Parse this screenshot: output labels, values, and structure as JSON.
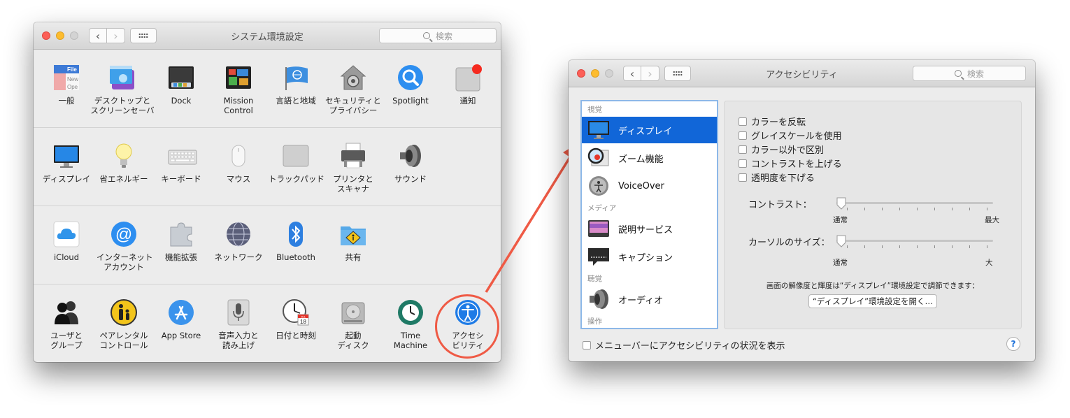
{
  "left_window": {
    "title": "システム環境設定",
    "search_placeholder": "検索",
    "back_glyph": "‹",
    "forward_glyph": "›",
    "rows": [
      [
        {
          "name": "general",
          "label": [
            "一般"
          ],
          "icon": "general-icon"
        },
        {
          "name": "desktop",
          "label": [
            "デスクトップと",
            "スクリーンセーバ"
          ],
          "icon": "desktop-icon"
        },
        {
          "name": "dock",
          "label": [
            "Dock"
          ],
          "icon": "dock-icon"
        },
        {
          "name": "mission-control",
          "label": [
            "Mission",
            "Control"
          ],
          "icon": "mission-control-icon"
        },
        {
          "name": "language",
          "label": [
            "言語と地域"
          ],
          "icon": "language-flag-icon"
        },
        {
          "name": "security",
          "label": [
            "セキュリティと",
            "プライバシー"
          ],
          "icon": "security-house-icon"
        },
        {
          "name": "spotlight",
          "label": [
            "Spotlight"
          ],
          "icon": "spotlight-icon"
        },
        {
          "name": "notifications",
          "label": [
            "通知"
          ],
          "icon": "notifications-icon"
        }
      ],
      [
        {
          "name": "displays",
          "label": [
            "ディスプレイ"
          ],
          "icon": "display-icon"
        },
        {
          "name": "energy",
          "label": [
            "省エネルギー"
          ],
          "icon": "lightbulb-icon"
        },
        {
          "name": "keyboard",
          "label": [
            "キーボード"
          ],
          "icon": "keyboard-icon"
        },
        {
          "name": "mouse",
          "label": [
            "マウス"
          ],
          "icon": "mouse-icon"
        },
        {
          "name": "trackpad",
          "label": [
            "トラックパッド"
          ],
          "icon": "trackpad-icon"
        },
        {
          "name": "printers",
          "label": [
            "プリンタと",
            "スキャナ"
          ],
          "icon": "printer-icon"
        },
        {
          "name": "sound",
          "label": [
            "サウンド"
          ],
          "icon": "speaker-icon"
        }
      ],
      [
        {
          "name": "icloud",
          "label": [
            "iCloud"
          ],
          "icon": "icloud-icon"
        },
        {
          "name": "internet-accounts",
          "label": [
            "インターネット",
            "アカウント"
          ],
          "icon": "at-sign-icon"
        },
        {
          "name": "extensions",
          "label": [
            "機能拡張"
          ],
          "icon": "puzzle-icon"
        },
        {
          "name": "network",
          "label": [
            "ネットワーク"
          ],
          "icon": "network-globe-icon"
        },
        {
          "name": "bluetooth",
          "label": [
            "Bluetooth"
          ],
          "icon": "bluetooth-icon"
        },
        {
          "name": "sharing",
          "label": [
            "共有"
          ],
          "icon": "sharing-folder-icon"
        }
      ],
      [
        {
          "name": "users",
          "label": [
            "ユーザと",
            "グループ"
          ],
          "icon": "users-icon"
        },
        {
          "name": "parental",
          "label": [
            "ペアレンタル",
            "コントロール"
          ],
          "icon": "parental-icon"
        },
        {
          "name": "app-store",
          "label": [
            "App Store"
          ],
          "icon": "app-store-icon"
        },
        {
          "name": "dictation",
          "label": [
            "音声入力と",
            "読み上げ"
          ],
          "icon": "microphone-icon"
        },
        {
          "name": "date-time",
          "label": [
            "日付と時刻"
          ],
          "icon": "clock-icon"
        },
        {
          "name": "startup-disk",
          "label": [
            "起動",
            "ディスク"
          ],
          "icon": "disk-icon"
        },
        {
          "name": "time-machine",
          "label": [
            "Time",
            "Machine"
          ],
          "icon": "time-machine-icon"
        },
        {
          "name": "accessibility",
          "label": [
            "アクセシ",
            "ビリティ"
          ],
          "icon": "accessibility-icon"
        }
      ]
    ],
    "icon_text": {
      "general_file": "File",
      "general_new": "New",
      "general_ope": "Ope",
      "calendar_day": "18",
      "calendar_month": "JUL"
    }
  },
  "right_window": {
    "title": "アクセシビリティ",
    "search_placeholder": "検索",
    "sidebar": {
      "sections": [
        {
          "header": "視覚",
          "items": [
            {
              "label": "ディスプレイ",
              "icon": "display-icon",
              "selected": true
            },
            {
              "label": "ズーム機能",
              "icon": "zoom-magnifier-icon",
              "selected": false
            },
            {
              "label": "VoiceOver",
              "icon": "voiceover-icon",
              "selected": false
            }
          ]
        },
        {
          "header": "メディア",
          "items": [
            {
              "label": "説明サービス",
              "icon": "descriptions-icon",
              "selected": false
            },
            {
              "label": "キャプション",
              "icon": "captions-icon",
              "selected": false
            }
          ]
        },
        {
          "header": "聴覚",
          "items": [
            {
              "label": "オーディオ",
              "icon": "audio-speaker-icon",
              "selected": false
            }
          ]
        },
        {
          "header": "操作",
          "items": []
        }
      ]
    },
    "checkboxes": [
      {
        "label": "カラーを反転",
        "checked": false
      },
      {
        "label": "グレイスケールを使用",
        "checked": false
      },
      {
        "label": "カラー以外で区別",
        "checked": false
      },
      {
        "label": "コントラストを上げる",
        "checked": false
      },
      {
        "label": "透明度を下げる",
        "checked": false
      }
    ],
    "contrast": {
      "label": "コントラスト：",
      "min_label": "通常",
      "max_label": "最大",
      "value": 0
    },
    "cursor_size": {
      "label": "カーソルのサイズ：",
      "min_label": "通常",
      "max_label": "大",
      "value": 0
    },
    "display_note": "画面の解像度と輝度は“ディスプレイ”環境設定で調節できます：",
    "open_display_button": "“ディスプレイ”環境設定を開く…",
    "menubar_checkbox": {
      "label": "メニューバーにアクセシビリティの状況を表示",
      "checked": false
    },
    "help_glyph": "?"
  },
  "colors": {
    "annotation": "#ef5a45",
    "selection": "#1166d8",
    "sidebar_border": "#8db8e8"
  }
}
